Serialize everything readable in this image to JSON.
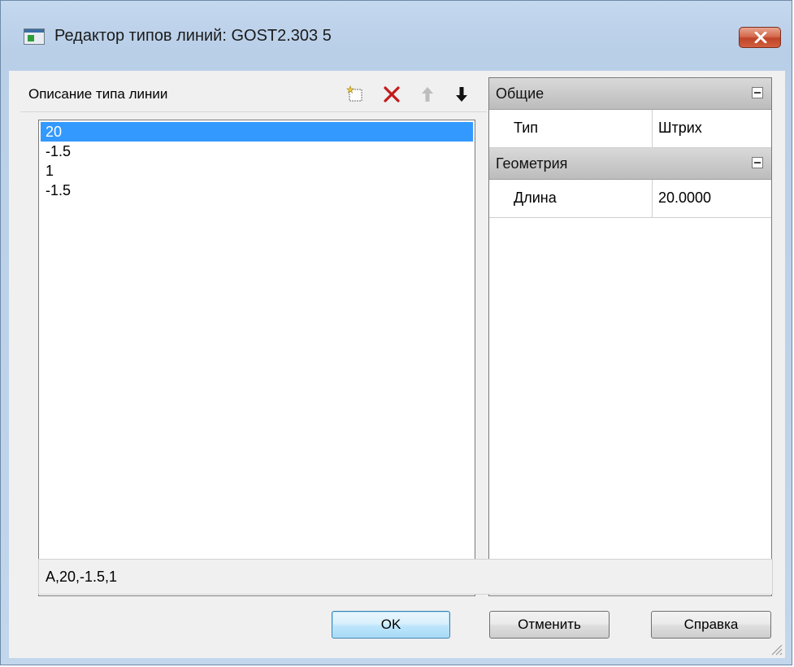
{
  "window": {
    "title": "Редактор типов линий: GOST2.303 5",
    "icon": "app-window-icon",
    "close_icon": "close-icon"
  },
  "linetype_panel": {
    "caption": "Описание типа линии",
    "toolbar": [
      {
        "name": "new-element-icon",
        "tooltip": ""
      },
      {
        "name": "delete-icon",
        "color": "#c41a1a"
      },
      {
        "name": "move-up-icon",
        "enabled": false
      },
      {
        "name": "move-down-icon",
        "enabled": true
      }
    ],
    "items": [
      "20",
      "-1.5",
      "1",
      "-1.5"
    ],
    "selected_index": 0
  },
  "properties": {
    "categories": [
      {
        "label": "Общие",
        "rows": [
          {
            "name": "Тип",
            "value": "Штрих"
          }
        ]
      },
      {
        "label": "Геометрия",
        "rows": [
          {
            "name": "Длина",
            "value": "20.0000"
          }
        ]
      }
    ]
  },
  "result": {
    "text": "A,20,-1.5,1"
  },
  "buttons": {
    "ok": "OK",
    "cancel": "Отменить",
    "help": "Справка"
  },
  "colors": {
    "selection": "#3399ff",
    "titlebar": "#b9cfe8",
    "close": "#c0442a"
  }
}
